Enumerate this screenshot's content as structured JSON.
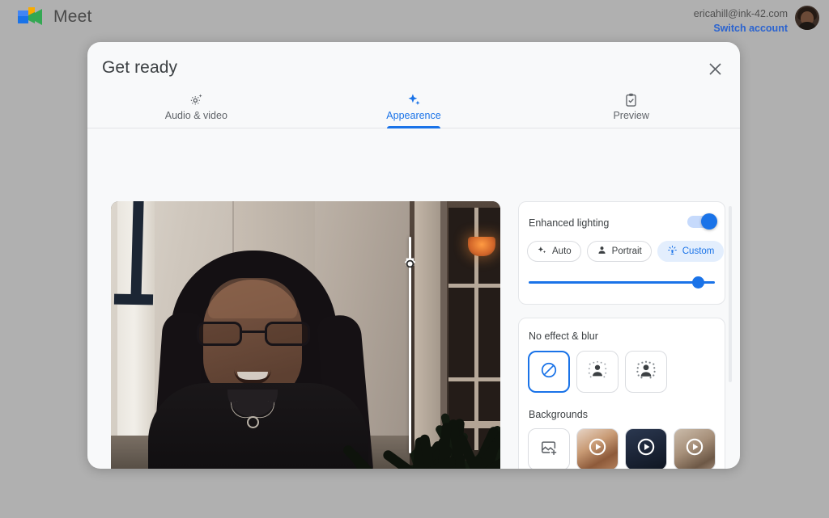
{
  "topbar": {
    "brand_name": "Meet",
    "logo_icon": "google-meet-logo",
    "account_email": "ericahill@ink-42.com",
    "switch_account_label": "Switch account",
    "avatar_icon": "user-avatar"
  },
  "dialog": {
    "title": "Get ready",
    "close_icon": "close-icon",
    "tabs": [
      {
        "label": "Audio & video",
        "icon": "gear-sparkle-icon",
        "active": false
      },
      {
        "label": "Appearence",
        "icon": "sparkles-icon",
        "active": true
      },
      {
        "label": "Preview",
        "icon": "clipboard-check-icon",
        "active": false
      }
    ]
  },
  "preview": {
    "name": "video-self-preview",
    "divider_icon": "brightness-compare-handle"
  },
  "lighting": {
    "title": "Enhanced lighting",
    "toggle_on": true,
    "presets": [
      {
        "label": "Auto",
        "icon": "sparkles-icon",
        "selected": false
      },
      {
        "label": "Portrait",
        "icon": "person-icon",
        "selected": false
      },
      {
        "label": "Custom",
        "icon": "lamp-icon",
        "selected": true
      }
    ],
    "slider_value": 92
  },
  "effects": {
    "title": "No effect & blur",
    "tiles": [
      {
        "name": "no-effect-tile",
        "icon": "no-effect-icon",
        "selected": true
      },
      {
        "name": "slight-blur-tile",
        "icon": "slight-blur-icon",
        "selected": false
      },
      {
        "name": "blur-tile",
        "icon": "blur-icon",
        "selected": false
      }
    ],
    "backgrounds_title": "Backgrounds",
    "backgrounds": [
      {
        "name": "upload-background-tile",
        "icon": "add-image-icon",
        "type": "upload"
      },
      {
        "name": "background-thumbnail",
        "icon": "play-icon",
        "type": "video",
        "color": "#c49a7e"
      },
      {
        "name": "background-thumbnail",
        "icon": "play-icon",
        "type": "video",
        "color": "#2a3344"
      },
      {
        "name": "background-thumbnail",
        "icon": "play-icon",
        "type": "video",
        "color": "#a79487"
      }
    ],
    "partial_backgrounds": [
      {
        "name": "background-thumbnail",
        "color": "#6c6f73"
      },
      {
        "name": "background-thumbnail",
        "color": "#b5aa9c"
      },
      {
        "name": "background-thumbnail",
        "color": "#c3b49d"
      },
      {
        "name": "background-thumbnail",
        "color": "#3a5aa8"
      }
    ]
  },
  "colors": {
    "accent": "#1a73e8",
    "accent_soft": "#e3eefd",
    "page_bg": "#b0b0b0",
    "dialog_bg": "#f8f9fa"
  }
}
